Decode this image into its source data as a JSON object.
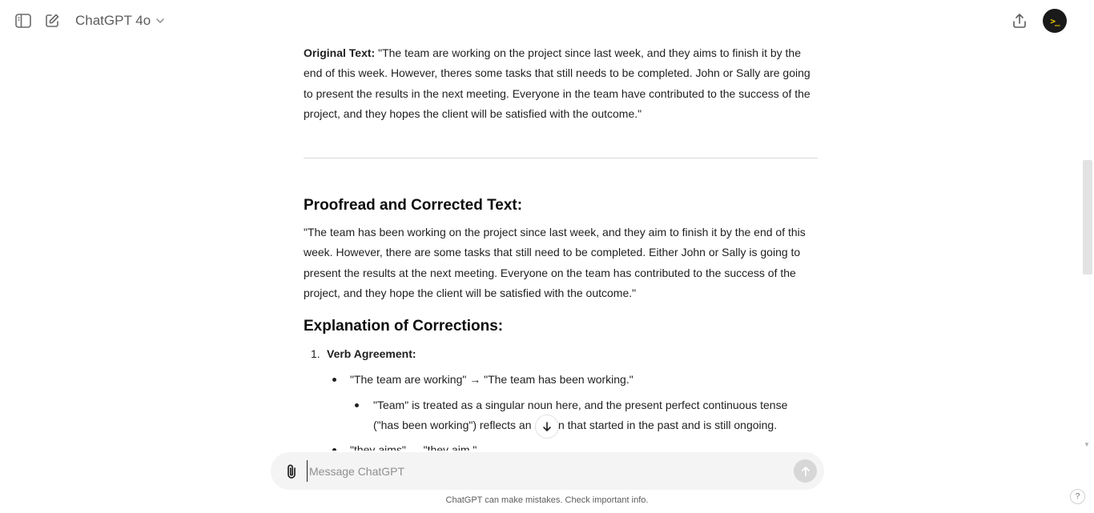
{
  "header": {
    "model_name": "ChatGPT 4o",
    "icons": {
      "sidebar": "sidebar-toggle-icon",
      "new_chat": "new-chat-icon",
      "chevron": "chevron-down-icon",
      "share": "share-icon",
      "avatar": "avatar"
    },
    "avatar_text": ">_"
  },
  "message": {
    "original_label": "Original Text:",
    "original_text": " \"The team are working on the project since last week, and they aims to finish it by the end of this week. However, theres some tasks that still needs to be completed. John or Sally are going to present the results in the next meeting. Everyone in the team have contributed to the success of the project, and they hopes the client will be satisfied with the outcome.\"",
    "corrected_heading": "Proofread and Corrected Text:",
    "corrected_text": "\"The team has been working on the project since last week, and they aim to finish it by the end of this week. However, there are some tasks that still need to be completed. Either John or Sally is going to present the results at the next meeting. Everyone on the team has contributed to the success of the project, and they hope the client will be satisfied with the outcome.\"",
    "explanation_heading": "Explanation of Corrections:",
    "list": [
      {
        "number": "1.",
        "title": "Verb Agreement:",
        "items": [
          {
            "text": "\"The team are working\" → \"The team has been working.\"",
            "sub": "\"Team\" is treated as a singular noun here, and the present perfect continuous tense (\"has been working\") reflects an action that started in the past and is still ongoing."
          },
          {
            "text": "\"they aims\" → \"they aim.\""
          }
        ]
      }
    ]
  },
  "composer": {
    "placeholder": "Message ChatGPT",
    "value": ""
  },
  "footer": {
    "disclaimer": "ChatGPT can make mistakes. Check important info.",
    "help": "?"
  },
  "colors": {
    "accent_avatar_bg": "#1a1a1a",
    "avatar_glyph": "#f5d300",
    "composer_bg": "#f4f4f4",
    "send_disabled": "#d7d7d7"
  }
}
